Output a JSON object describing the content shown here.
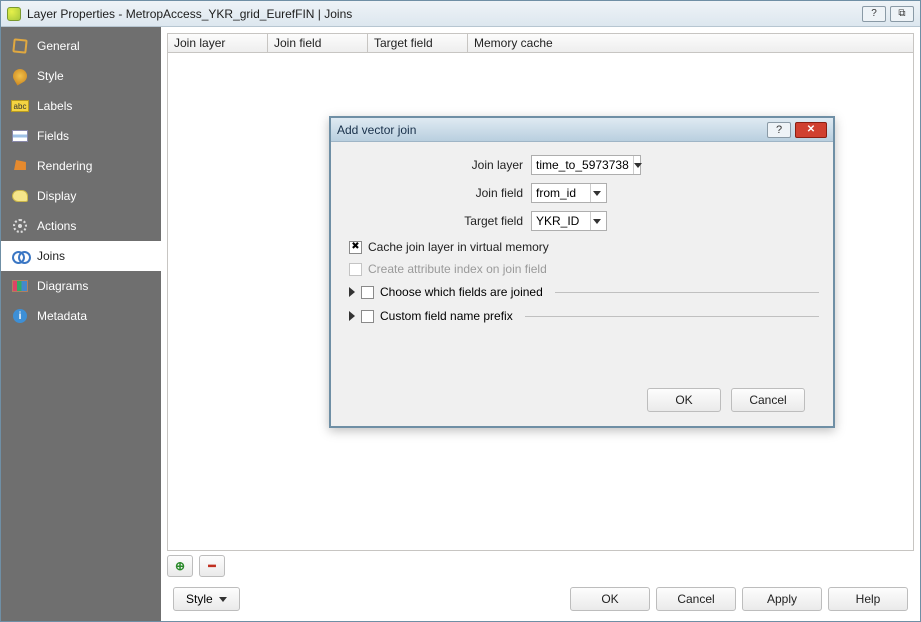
{
  "window": {
    "title": "Layer Properties - MetropAccess_YKR_grid_EurefFIN | Joins",
    "help_glyph": "?",
    "close_glyph": "⧉"
  },
  "sidebar": {
    "items": [
      {
        "label": "General"
      },
      {
        "label": "Style"
      },
      {
        "label": "Labels",
        "chip": "abc"
      },
      {
        "label": "Fields"
      },
      {
        "label": "Rendering"
      },
      {
        "label": "Display"
      },
      {
        "label": "Actions"
      },
      {
        "label": "Joins"
      },
      {
        "label": "Diagrams"
      },
      {
        "label": "Metadata",
        "chip": "i"
      }
    ],
    "selected": "Joins"
  },
  "joins_table": {
    "columns": [
      "Join layer",
      "Join field",
      "Target field",
      "Memory cache"
    ]
  },
  "toolbar": {
    "add_glyph": "⊕",
    "remove_glyph": "━"
  },
  "footer": {
    "style_label": "Style",
    "ok": "OK",
    "cancel": "Cancel",
    "apply": "Apply",
    "help": "Help"
  },
  "modal": {
    "title": "Add vector join",
    "help_glyph": "?",
    "close_glyph": "✕",
    "fields": {
      "join_layer": {
        "label": "Join layer",
        "value": "time_to_5973738"
      },
      "join_field": {
        "label": "Join field",
        "value": "from_id"
      },
      "target_field": {
        "label": "Target field",
        "value": "YKR_ID"
      }
    },
    "cache_label": "Cache join layer in virtual memory",
    "cache_checked": true,
    "index_label": "Create attribute index on join field",
    "index_enabled": false,
    "choose_fields_label": "Choose which fields are joined",
    "prefix_label": "Custom field name prefix",
    "ok": "OK",
    "cancel": "Cancel"
  }
}
